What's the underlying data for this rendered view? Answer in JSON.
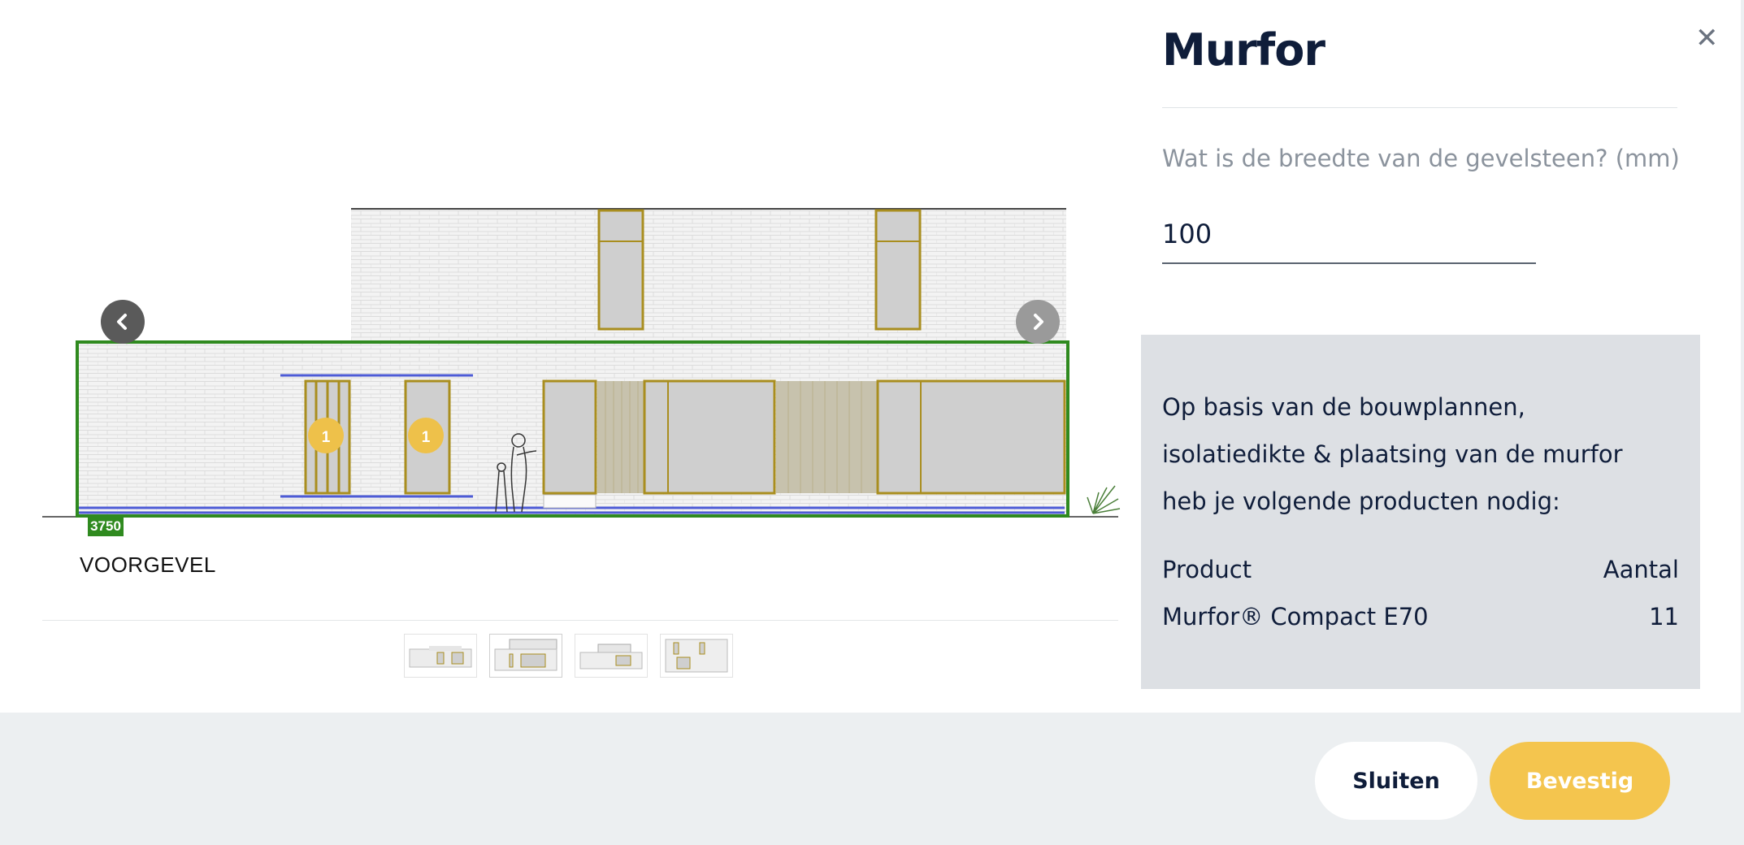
{
  "panel": {
    "title": "Murfor",
    "question": "Wat is de breedte van de gevelsteen? (mm)",
    "width_value": "100"
  },
  "result": {
    "description": "Op basis van de bouwplannen, isolatiedikte & plaatsing van de murfor heb je volgende producten nodig:",
    "table": {
      "headers": [
        "Product",
        "Aantal"
      ],
      "rows": [
        {
          "product": "Murfor® Compact E70",
          "amount": "11"
        }
      ]
    }
  },
  "drawing": {
    "facade_label": "VOORGEVEL",
    "dimension": "3750",
    "markers": [
      "1",
      "1"
    ]
  },
  "thumbnails": [
    "thumbnail-1",
    "thumbnail-2",
    "thumbnail-3",
    "thumbnail-4"
  ],
  "footer": {
    "close_label": "Sluiten",
    "confirm_label": "Bevestig"
  },
  "icons": [
    "chevron-left-icon",
    "chevron-right-icon",
    "close-icon"
  ],
  "colors": {
    "accent_yellow": "#f4c54e",
    "selection_green": "#2f8a1f",
    "text_navy": "#0f1d3a",
    "result_bg": "#dde0e4",
    "footer_bg": "#eceff1"
  }
}
